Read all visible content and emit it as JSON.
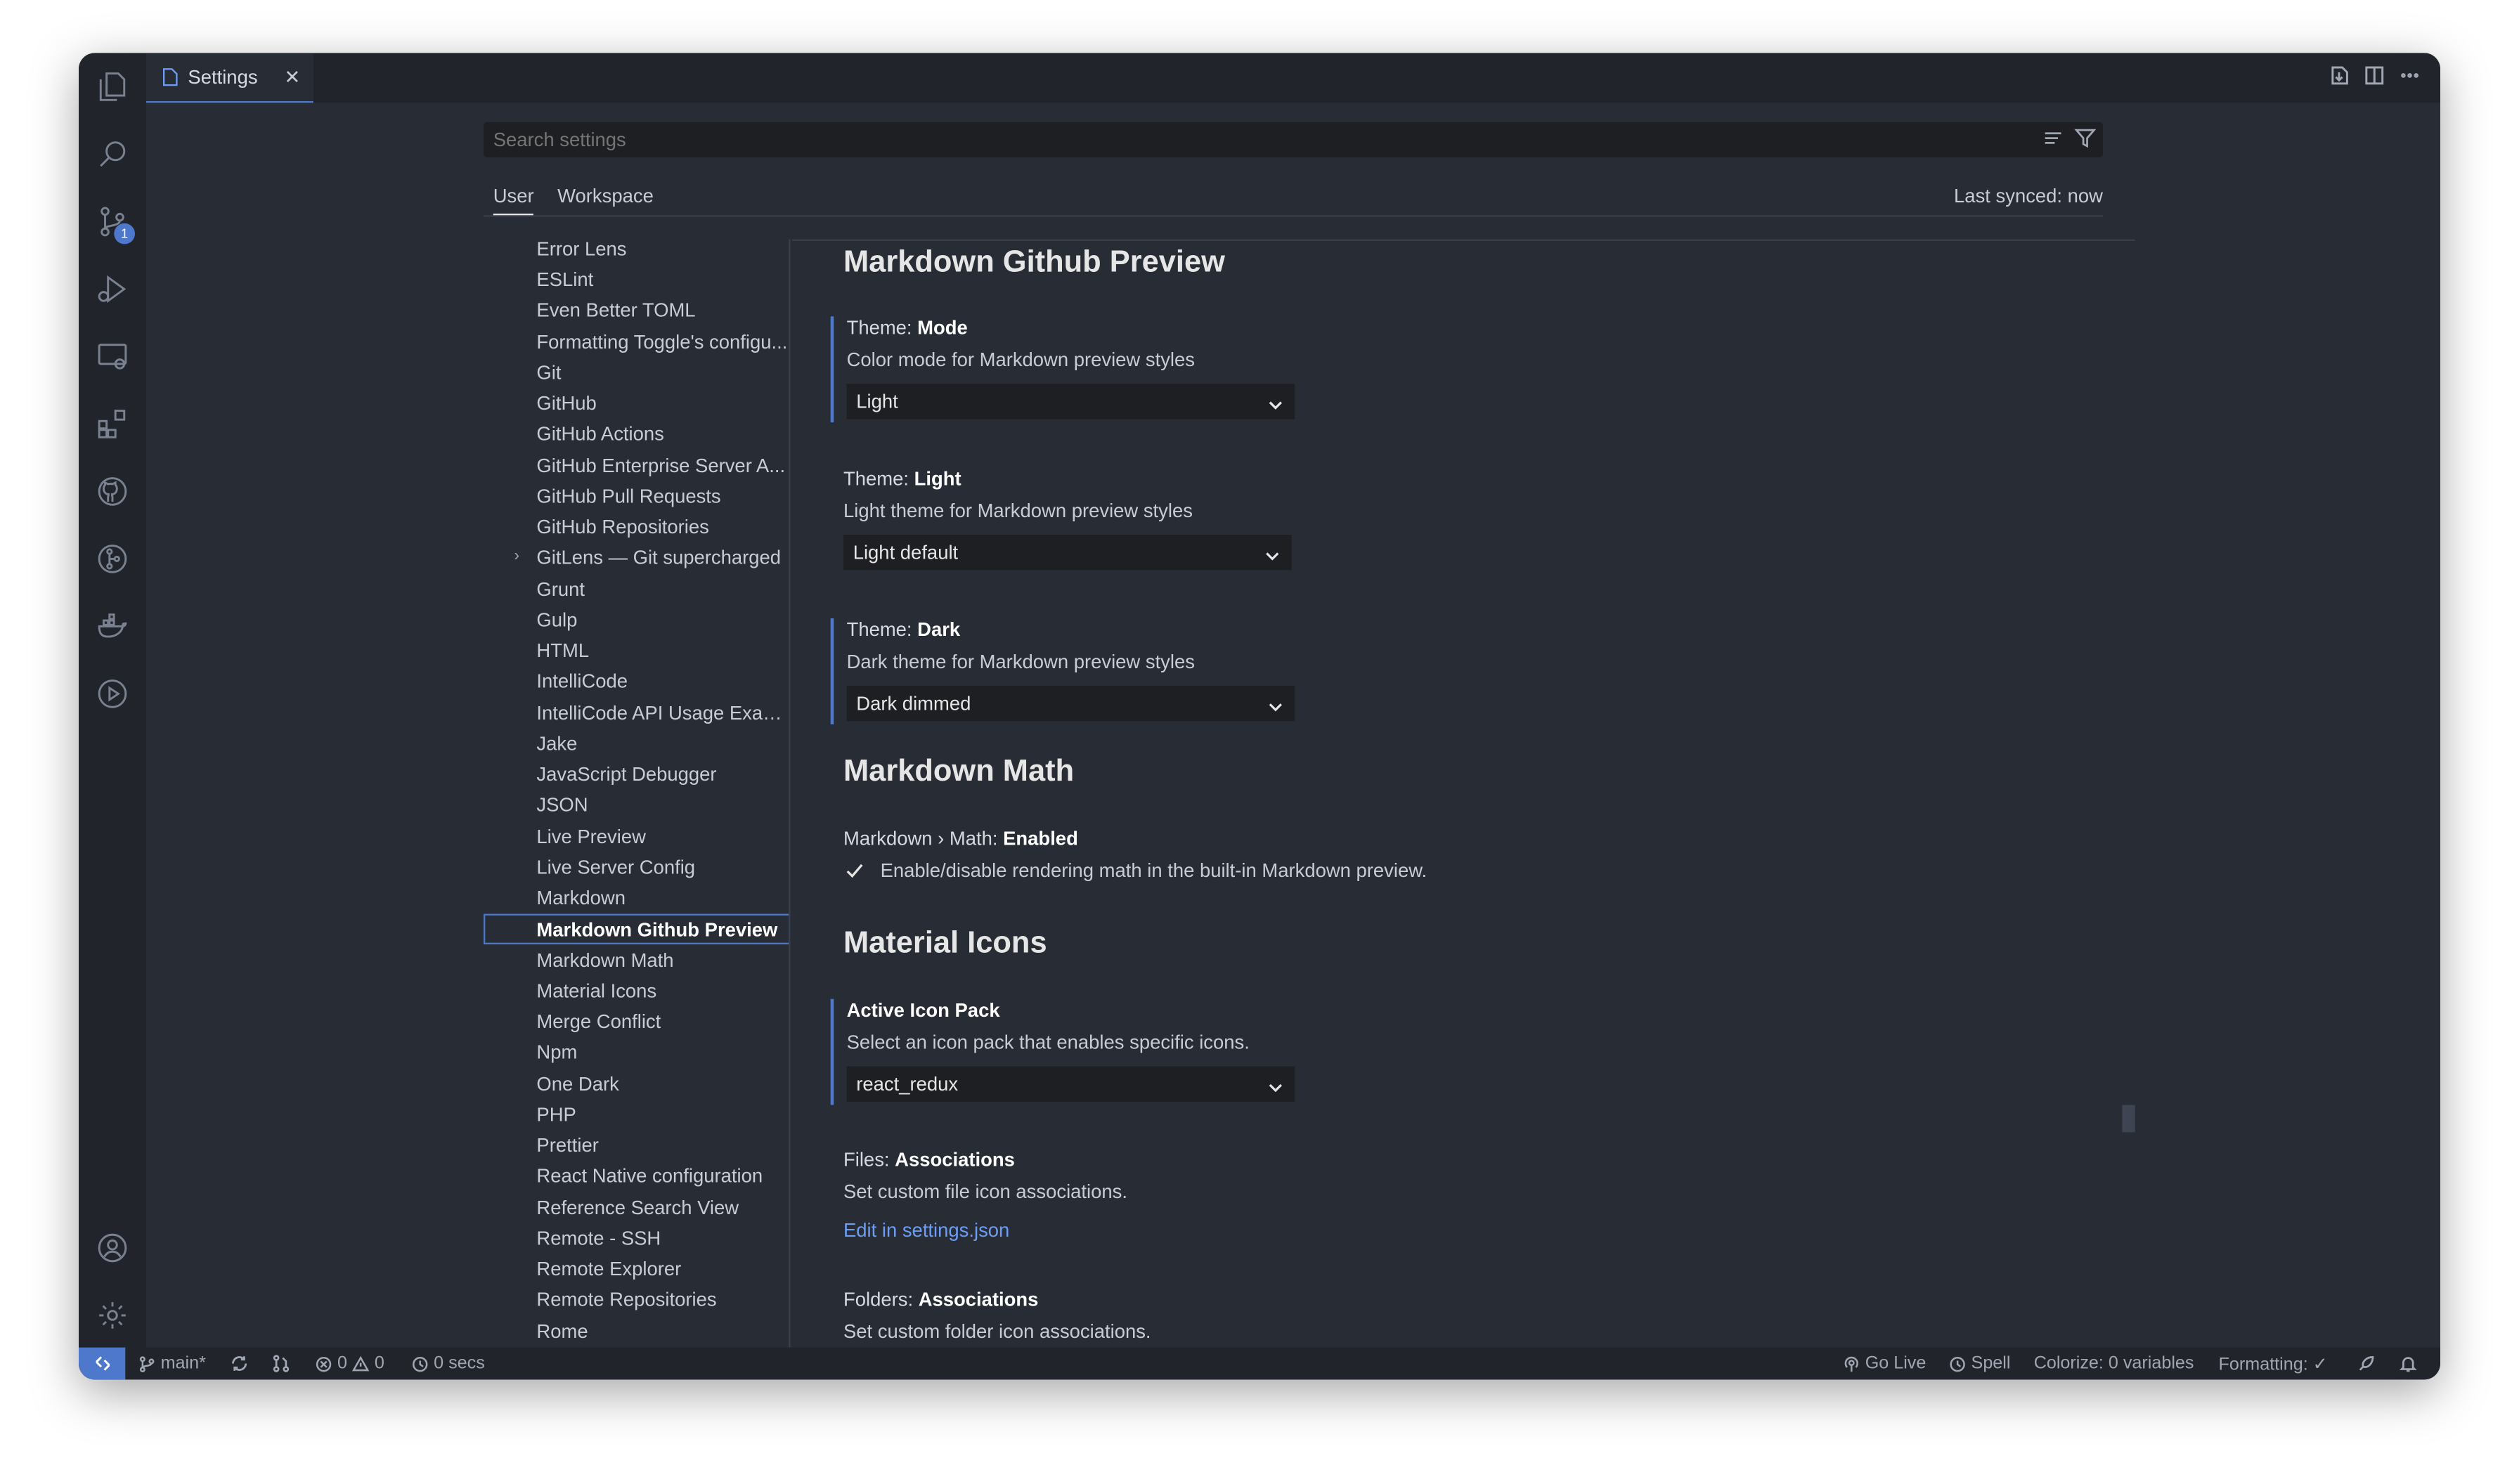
{
  "tab": {
    "title": "Settings",
    "close": "✕"
  },
  "search": {
    "placeholder": "Search settings"
  },
  "scope": {
    "user": "User",
    "workspace": "Workspace",
    "synced": "Last synced: now"
  },
  "badge": "1",
  "toc": [
    "Error Lens",
    "ESLint",
    "Even Better TOML",
    "Formatting Toggle's configu...",
    "Git",
    "GitHub",
    "GitHub Actions",
    "GitHub Enterprise Server A...",
    "GitHub Pull Requests",
    "GitHub Repositories",
    "GitLens — Git supercharged",
    "Grunt",
    "Gulp",
    "HTML",
    "IntelliCode",
    "IntelliCode API Usage Exam...",
    "Jake",
    "JavaScript Debugger",
    "JSON",
    "Live Preview",
    "Live Server Config",
    "Markdown",
    "Markdown Github Preview",
    "Markdown Math",
    "Material Icons",
    "Merge Conflict",
    "Npm",
    "One Dark",
    "PHP",
    "Prettier",
    "React Native configuration",
    "Reference Search View",
    "Remote - SSH",
    "Remote Explorer",
    "Remote Repositories",
    "Rome"
  ],
  "sections": {
    "mgp": "Markdown Github Preview",
    "mm": "Markdown Math",
    "mi": "Material Icons"
  },
  "settings": {
    "mode": {
      "prefix": "Theme: ",
      "name": "Mode",
      "desc": "Color mode for Markdown preview styles",
      "value": "Light"
    },
    "light": {
      "prefix": "Theme: ",
      "name": "Light",
      "desc": "Light theme for Markdown preview styles",
      "value": "Light default"
    },
    "dark": {
      "prefix": "Theme: ",
      "name": "Dark",
      "desc": "Dark theme for Markdown preview styles",
      "value": "Dark dimmed"
    },
    "math": {
      "prefix": "Markdown › Math: ",
      "name": "Enabled",
      "desc": "Enable/disable rendering math in the built-in Markdown preview."
    },
    "iconpack": {
      "name": "Active Icon Pack",
      "desc": "Select an icon pack that enables specific icons.",
      "value": "react_redux"
    },
    "files": {
      "prefix": "Files: ",
      "name": "Associations",
      "desc": "Set custom file icon associations.",
      "link": "Edit in settings.json"
    },
    "folders": {
      "prefix": "Folders: ",
      "name": "Associations",
      "desc": "Set custom folder icon associations."
    }
  },
  "status": {
    "branch": "main*",
    "errors": "0",
    "warnings": "0",
    "time": "0 secs",
    "golive": "Go Live",
    "spell": "Spell",
    "colorize": "Colorize: 0 variables",
    "formatting": "Formatting: ✓"
  }
}
